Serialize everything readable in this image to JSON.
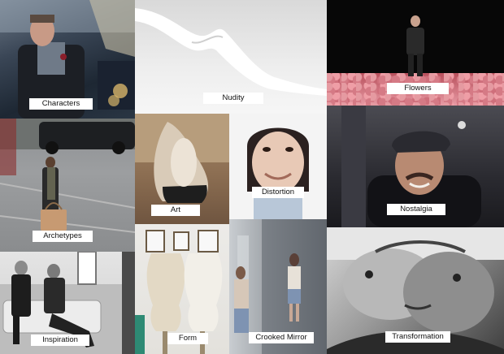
{
  "collage": {
    "tiles": [
      {
        "label": "Characters"
      },
      {
        "label": "Nudity"
      },
      {
        "label": "Flowers"
      },
      {
        "label": "Archetypes"
      },
      {
        "label": "Art"
      },
      {
        "label": "Distortion"
      },
      {
        "label": "Nostalgia"
      },
      {
        "label": "Inspiration"
      },
      {
        "label": "Form"
      },
      {
        "label": "Crooked Mirror"
      },
      {
        "label": "Transformation"
      }
    ]
  }
}
